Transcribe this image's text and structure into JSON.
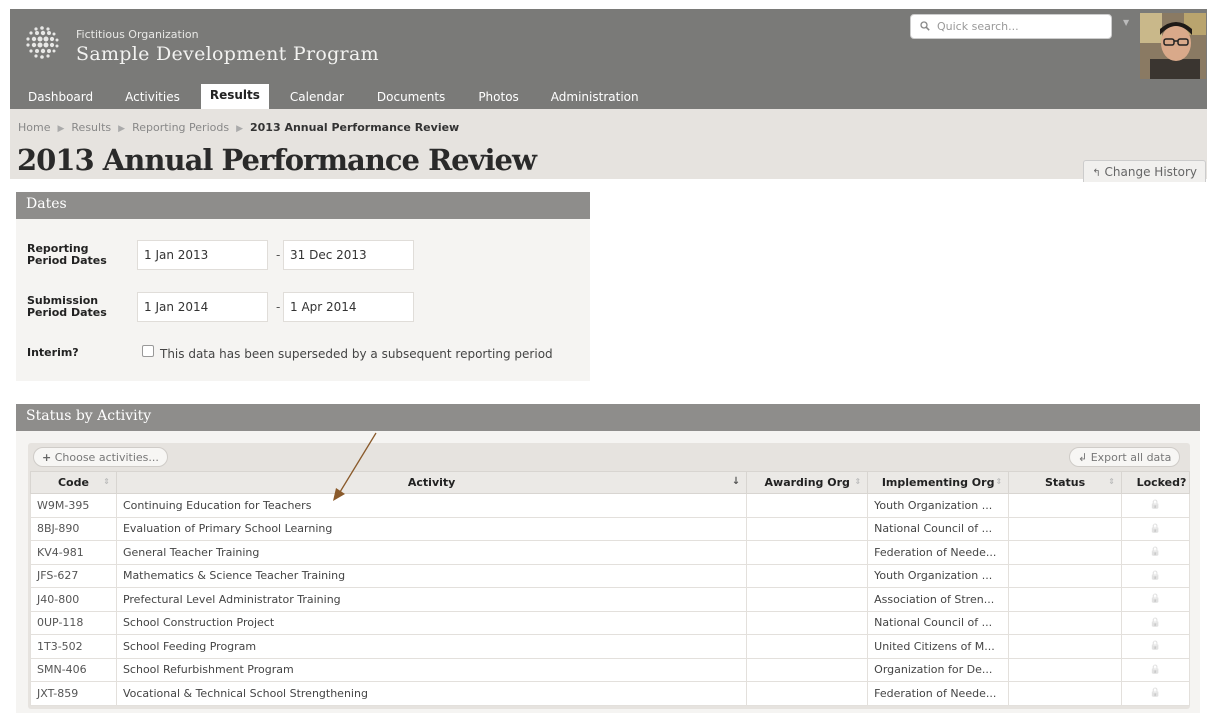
{
  "header": {
    "org_name": "Fictitious Organization",
    "program_name": "Sample Development Program",
    "search_placeholder": "Quick search..."
  },
  "nav": [
    {
      "label": "Dashboard",
      "active": false
    },
    {
      "label": "Activities",
      "active": false
    },
    {
      "label": "Results",
      "active": true
    },
    {
      "label": "Calendar",
      "active": false
    },
    {
      "label": "Documents",
      "active": false
    },
    {
      "label": "Photos",
      "active": false
    },
    {
      "label": "Administration",
      "active": false
    }
  ],
  "breadcrumb": [
    "Home",
    "Results",
    "Reporting Periods",
    "2013 Annual Performance Review"
  ],
  "page_title": "2013 Annual Performance Review",
  "change_history_label": "Change History",
  "dates": {
    "heading": "Dates",
    "reporting_label": "Reporting Period Dates",
    "reporting_start": "1 Jan 2013",
    "reporting_end": "31 Dec 2013",
    "submission_label": "Submission Period Dates",
    "submission_start": "1 Jan 2014",
    "submission_end": "1 Apr 2014",
    "interim_label": "Interim?",
    "interim_text": "This data has been superseded by a subsequent reporting period",
    "interim_checked": false
  },
  "status": {
    "heading": "Status by Activity",
    "choose_label": "Choose activities...",
    "export_label": "Export all data",
    "columns": [
      "Code",
      "Activity",
      "Awarding Org",
      "Implementing Org",
      "Status",
      "Locked?"
    ],
    "rows": [
      {
        "code": "W9M-395",
        "activity": "Continuing Education for Teachers",
        "awarding": "",
        "implementing": "Youth Organization ...",
        "status": ""
      },
      {
        "code": "8BJ-890",
        "activity": "Evaluation of Primary School Learning",
        "awarding": "",
        "implementing": "National Council of ...",
        "status": ""
      },
      {
        "code": "KV4-981",
        "activity": "General Teacher Training",
        "awarding": "",
        "implementing": "Federation of Neede...",
        "status": ""
      },
      {
        "code": "JFS-627",
        "activity": "Mathematics & Science Teacher Training",
        "awarding": "",
        "implementing": "Youth Organization ...",
        "status": ""
      },
      {
        "code": "J40-800",
        "activity": "Prefectural Level Administrator Training",
        "awarding": "",
        "implementing": "Association of Stren...",
        "status": ""
      },
      {
        "code": "0UP-118",
        "activity": "School Construction Project",
        "awarding": "",
        "implementing": "National Council of ...",
        "status": ""
      },
      {
        "code": "1T3-502",
        "activity": "School Feeding Program",
        "awarding": "",
        "implementing": "United Citizens of M...",
        "status": ""
      },
      {
        "code": "SMN-406",
        "activity": "School Refurbishment Program",
        "awarding": "",
        "implementing": "Organization for De...",
        "status": ""
      },
      {
        "code": "JXT-859",
        "activity": "Vocational & Technical School Strengthening",
        "awarding": "",
        "implementing": "Federation of Neede...",
        "status": ""
      }
    ]
  },
  "colors": {
    "header_bg": "#7a7a78",
    "subheader_bg": "#e6e3df",
    "panel_header_bg": "#8e8d8b",
    "annotation_arrow": "#8a5a2b"
  }
}
